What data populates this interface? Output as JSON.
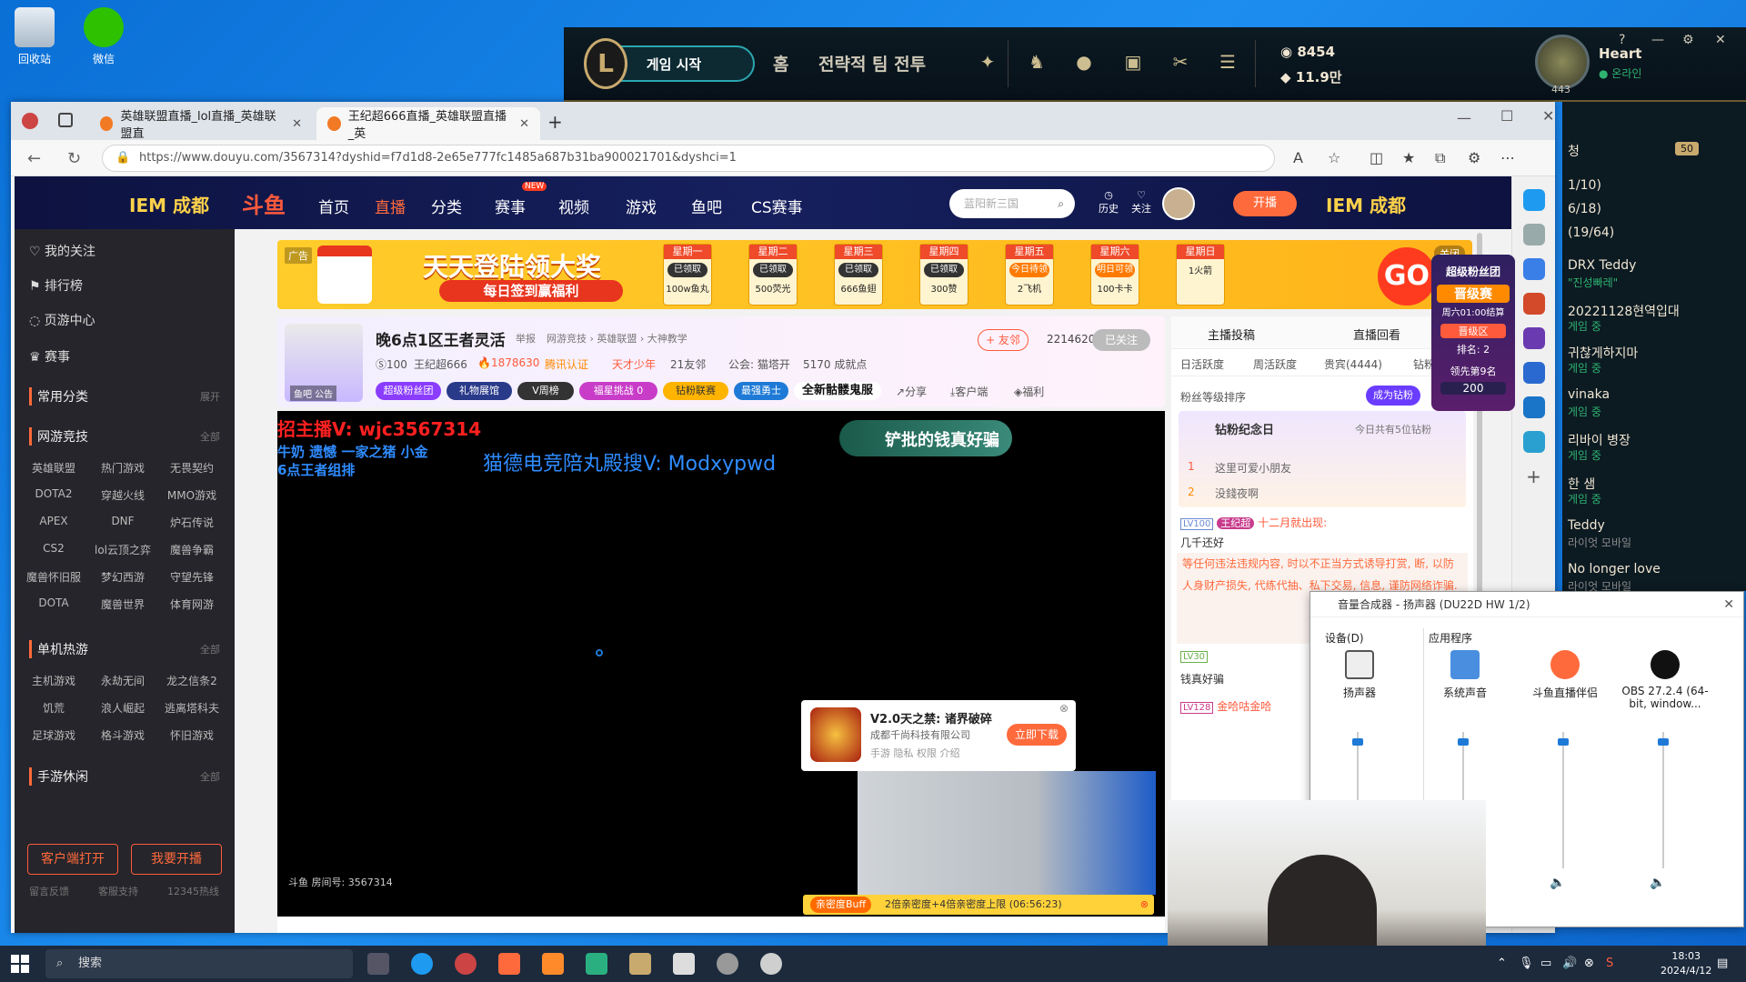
{
  "desktop": {
    "icons": [
      {
        "label": "回收站"
      },
      {
        "label": "微信"
      }
    ]
  },
  "lol_client": {
    "logo": "L",
    "play_button": "게임 시작",
    "home": "홈",
    "mode": "전략적 팀 전투",
    "currency_rp": "8454",
    "currency_be": "11.9만",
    "level": "443",
    "summoner_name": "Heart",
    "status": "온라인",
    "window_buttons": [
      "?",
      "—",
      "⚙",
      "✕"
    ]
  },
  "right_panel": {
    "count_badge": "50",
    "rows": [
      {
        "text": "청",
        "sub": ""
      },
      {
        "text": "1/10)",
        "sub": ""
      },
      {
        "text": "6/18)",
        "sub": ""
      },
      {
        "text": "(19/64)",
        "sub": ""
      },
      {
        "text": "DRX Teddy",
        "sub": "\"진성빠레\""
      },
      {
        "text": "20221128현역입대",
        "sub": "게임 중"
      },
      {
        "text": "귀찮게하지마",
        "sub": "게임 중"
      },
      {
        "text": "vinaka",
        "sub": "게임 중"
      },
      {
        "text": "리바이 병장",
        "sub": "게임 중"
      },
      {
        "text": "한 샘",
        "sub": "게임 중"
      },
      {
        "text": "Teddy",
        "sub": "라이엇 모바일"
      },
      {
        "text": "No longer love",
        "sub": "라이엇 모바일"
      }
    ]
  },
  "browser": {
    "tabs": [
      {
        "title": "英雄联盟直播_lol直播_英雄联盟直"
      },
      {
        "title": "王纪超666直播_英雄联盟直播_英"
      }
    ],
    "url": "https://www.douyu.com/3567314?dyshid=f7d1d8-2e65e777fc1485a687b31ba900021701&dyshci=1"
  },
  "douyu": {
    "header": {
      "iem_left": "IEM 成都",
      "logo": "斗鱼",
      "menu": [
        "首页",
        "直播",
        "分类",
        "赛事",
        "视频",
        "游戏",
        "鱼吧",
        "CS赛事"
      ],
      "new_badge": "NEW",
      "search_placeholder": "蓝阳新三国",
      "history": "历史",
      "follow": "关注",
      "live_button": "开播",
      "iem_right": "IEM 成都"
    },
    "leftnav": {
      "items": [
        "我的关注",
        "排行榜",
        "页游中心",
        "赛事"
      ],
      "common": "常用分类",
      "common_more": "展开",
      "net_games": "网游竞技",
      "net_more": "全部",
      "net_list": [
        "英雄联盟",
        "热门游戏",
        "无畏契约",
        "DOTA2",
        "穿越火线",
        "MMO游戏",
        "APEX",
        "DNF",
        "炉石传说",
        "CS2",
        "lol云顶之弈",
        "魔兽争霸",
        "魔兽怀旧服",
        "梦幻西游",
        "守望先锋",
        "DOTA",
        "魔兽世界",
        "体育网游"
      ],
      "single_games": "单机热游",
      "single_more": "全部",
      "single_list": [
        "主机游戏",
        "永劫无间",
        "龙之信条2",
        "饥荒",
        "浪人崛起",
        "逃离塔科夫",
        "足球游戏",
        "格斗游戏",
        "怀旧游戏"
      ],
      "mobile": "手游休闲",
      "mobile_more": "全部",
      "client_button": "客户端打开",
      "live_button": "我要开播",
      "footer": [
        "留言反馈",
        "客服支持",
        "12345热线"
      ]
    },
    "banner": {
      "ad": "广告",
      "title": "天天登陆领大奖",
      "subtitle": "每日签到赢福利",
      "days": [
        {
          "day": "星期一",
          "state": "已领取",
          "reward": "100w鱼丸"
        },
        {
          "day": "星期二",
          "state": "已领取",
          "reward": "500荧光"
        },
        {
          "day": "星期三",
          "state": "已领取",
          "reward": "666鱼翅"
        },
        {
          "day": "星期四",
          "state": "已领取",
          "reward": "300赞"
        },
        {
          "day": "星期五",
          "state": "今日待领",
          "reward": "2飞机"
        },
        {
          "day": "星期六",
          "state": "明日可领",
          "reward": "100卡卡"
        },
        {
          "day": "星期日",
          "state": "",
          "reward": "1火箭"
        }
      ],
      "go": "GO",
      "close": "关闭"
    },
    "room": {
      "title": "晚6点1区王者灵活",
      "report": "举报",
      "category": "网游竞技 › 英雄联盟 › 大神教学",
      "level_badge": "100",
      "streamer": "王纪超666",
      "heat": "1878630",
      "tencent": "腾讯认证",
      "team": "天才少年",
      "friends": "21友邻",
      "guild": "公会: 猫塔开",
      "achievement": "5170 成就点",
      "follow_button": "+ 友邻",
      "follower_count": "2214620",
      "followed": "已关注",
      "chips": [
        "超级粉丝团",
        "礼物展馆",
        "V周榜",
        "福星挑战 0",
        "钻粉联赛",
        "最强勇士",
        "全新骷髅鬼服"
      ],
      "share": "分享",
      "client": "客户端",
      "welfare": "福利",
      "avatar_label": "鱼吧 公告"
    },
    "video": {
      "overlay1": "招主播V: wjc3567314",
      "overlay2": "牛奶  遗憾  一家之猪 小金",
      "overlay3": "6点王者组排",
      "overlay4": "猫德电竞陪丸殿搜V: Modxypwd",
      "overlay5": "铲批的钱真好骗",
      "room_label": "斗鱼 房间号: 3567314",
      "popup_title": "V2.0天之禁: 诸界破碎",
      "popup_company": "成都千尚科技有限公司",
      "popup_tags": "手游  隐私  权限  介绍",
      "popup_button": "立即下载",
      "buff_label": "亲密度Buff",
      "buff_text": "2倍亲密度+4倍亲密度上限 (06:56:23)"
    },
    "chat": {
      "tab_posts": "主播投稿",
      "tab_replay": "直播回看",
      "subtabs": [
        "日活跃度",
        "周活跃度",
        "贵宾(4444)",
        "钻粉"
      ],
      "fan_rank": "粉丝等级排序",
      "become_fan": "成为钻粉",
      "diamond_day": "钻粉纪念日",
      "today": "今日共有5位钻粉",
      "rank1": "这里可爱小朋友",
      "rank2": "没錢夜啊",
      "msg1_level": "LV100",
      "msg1_tag": "王纪超",
      "msg1_text": "十二月就出现:",
      "msg1_body": "几千还好",
      "notice": "等任何违法违规内容, 时以不正当方式诱导打赏, 断, 以防人身财产损失, 代练代抽、私下交易, 信息, 谨防网络诈骗.",
      "msg2_level": "LV30",
      "msg2_text": "钱真好骗",
      "msg3_level": "LV128",
      "msg3_text": "金哈咕金哈"
    },
    "rank_card": {
      "title": "超级粉丝团",
      "stage": "晋级赛",
      "time": "周六01:00结算",
      "zone": "晋级区",
      "rank": "排名: 2",
      "lead": "领先第9名",
      "points": "200"
    }
  },
  "mixer": {
    "title": "音量合成器 - 扬声器 (DU22D HW 1/2)",
    "device_header": "设备(D)",
    "apps_header": "应用程序",
    "columns": [
      {
        "label": "扬声器",
        "level": 0.95
      },
      {
        "label": "系统声音",
        "level": 0.95
      },
      {
        "label": "斗鱼直播伴侣",
        "level": 0.95
      },
      {
        "label": "OBS 27.2.4 (64-bit, window...",
        "level": 0.95
      }
    ]
  },
  "taskbar": {
    "search": "搜索",
    "time": "18:03",
    "date": "2024/4/12"
  }
}
